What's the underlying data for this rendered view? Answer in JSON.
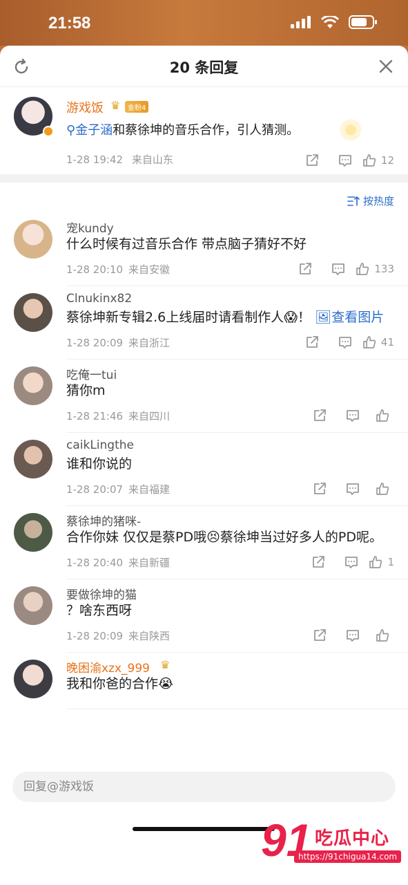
{
  "status_bar": {
    "time": "21:58"
  },
  "header": {
    "title": "20 条回复"
  },
  "original_post": {
    "username": "游戏饭",
    "fan_badge": "金粉4",
    "topic": "金子涵",
    "text": "和蔡徐坤的音乐合作，引人猜测。",
    "time": "1-28 19:42",
    "location": "来自山东",
    "likes": "12"
  },
  "sort": {
    "label": "按热度"
  },
  "comments": [
    {
      "name": "宠kundy",
      "text": "什么时候有过音乐合作 带点脑子猜好不好",
      "time": "1-28 20:10",
      "location": "来自安徽",
      "likes": "133"
    },
    {
      "name": "Clnukinx82",
      "text": "蔡徐坤新专辑2.6上线届时请看制作人😱！",
      "link": "查看图片",
      "time": "1-28 20:09",
      "location": "来自浙江",
      "likes": "41"
    },
    {
      "name": "吃俺一tui",
      "text": "猜你m",
      "time": "1-28 21:46",
      "location": "来自四川",
      "likes": ""
    },
    {
      "name": "caikLingthe",
      "text": "谁和你说的",
      "time": "1-28 20:07",
      "location": "来自福建",
      "likes": ""
    },
    {
      "name": "蔡徐坤的猪咪-",
      "text": "合作你妹 仅仅是蔡PD哦😣蔡徐坤当过好多人的PD呢。",
      "time": "1-28 20:40",
      "location": "来自新疆",
      "likes": "1"
    },
    {
      "name": "要做徐坤的猫",
      "text": "？啥东西呀",
      "time": "1-28 20:09",
      "location": "来自陕西",
      "likes": ""
    },
    {
      "name": "晚困渝xzx_999",
      "text": "我和你爸的合作😭",
      "time": "",
      "location": "",
      "likes": ""
    }
  ],
  "reply_input": {
    "placeholder": "回复@游戏饭"
  },
  "watermark": {
    "big": "91",
    "cn": "吃瓜中心",
    "url": "https://91chigua14.com"
  }
}
